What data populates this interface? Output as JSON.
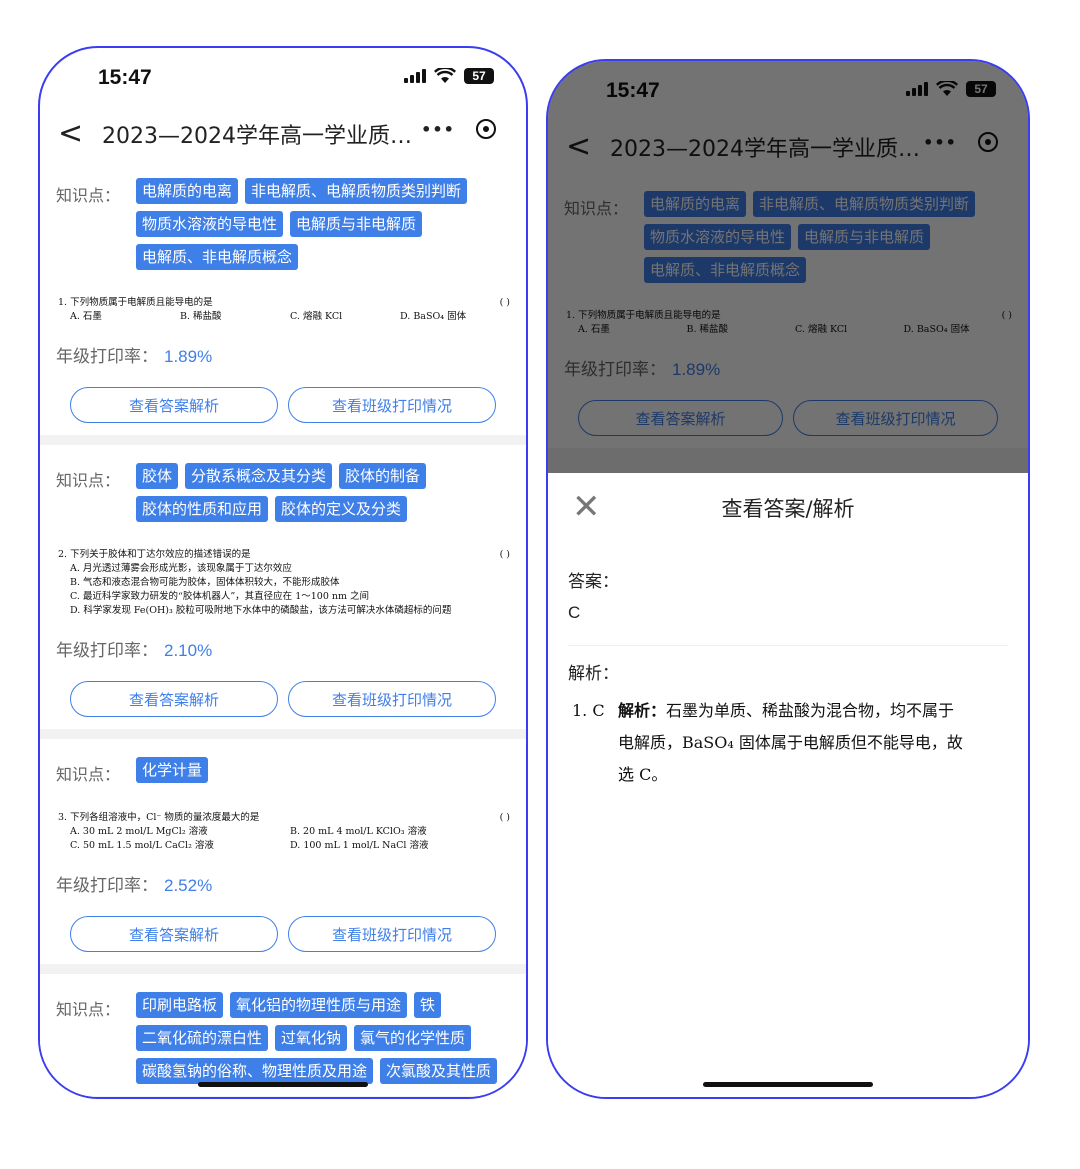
{
  "status": {
    "time": "15:47",
    "battery": "57"
  },
  "nav": {
    "title": "2023—2024学年高一学业质…",
    "back": "<",
    "more": "•••"
  },
  "kp_label": "知识点：",
  "rate_label": "年级打印率：",
  "buttons": {
    "answer": "查看答案解析",
    "class_print": "查看班级打印情况"
  },
  "cards": [
    {
      "tags": [
        "电解质的电离",
        "非电解质、电解质物质类别判断",
        "物质水溶液的导电性",
        "电解质与非电解质",
        "电解质、非电解质概念"
      ],
      "question": {
        "stem": "1. 下列物质属于电解质且能导电的是",
        "paren": "(    )",
        "options": [
          "A. 石墨",
          "B. 稀盐酸",
          "C. 熔融 KCl",
          "D. BaSO₄ 固体"
        ]
      },
      "rate": "1.89%"
    },
    {
      "tags": [
        "胶体",
        "分散系概念及其分类",
        "胶体的制备",
        "胶体的性质和应用",
        "胶体的定义及分类"
      ],
      "question": {
        "stem": "2. 下列关于胶体和丁达尔效应的描述错误的是",
        "paren": "(    )",
        "lines": [
          "A. 月光透过薄雾会形成光影，该现象属于丁达尔效应",
          "B. 气态和液态混合物可能为胶体，固体体积较大，不能形成胶体",
          "C. 最近科学家致力研发的“胶体机器人”，其直径应在 1～100 nm 之间",
          "D. 科学家发现 Fe(OH)₃ 胶粒可吸附地下水体中的磷酸盐，该方法可解决水体磷超标的问题"
        ]
      },
      "rate": "2.10%"
    },
    {
      "tags": [
        "化学计量"
      ],
      "question": {
        "stem": "3. 下列各组溶液中，Cl⁻ 物质的量浓度最大的是",
        "paren": "(    )",
        "options": [
          "A. 30 mL 2 mol/L MgCl₂ 溶液",
          "B. 20 mL 4 mol/L KClO₃ 溶液",
          "C. 50 mL 1.5 mol/L CaCl₂ 溶液",
          "D. 100 mL 1 mol/L NaCl 溶液"
        ]
      },
      "rate": "2.52%"
    },
    {
      "tags": [
        "印刷电路板",
        "氧化铝的物理性质与用途",
        "铁",
        "二氧化硫的漂白性",
        "过氧化钠",
        "氯气的化学性质",
        "碳酸氢钠的俗称、物理性质及用途",
        "次氯酸及其性质"
      ]
    }
  ],
  "sheet": {
    "title": "查看答案/解析",
    "close": "✕",
    "answer_label": "答案：",
    "answer_value": "C",
    "analysis_label": "解析：",
    "analysis_num": "1. C",
    "analysis_bold": "解析：",
    "analysis_line1": "石墨为单质、稀盐酸为混合物，均不属于",
    "analysis_line2": "电解质，BaSO₄ 固体属于电解质但不能导电，故",
    "analysis_line3": "选 C。"
  }
}
